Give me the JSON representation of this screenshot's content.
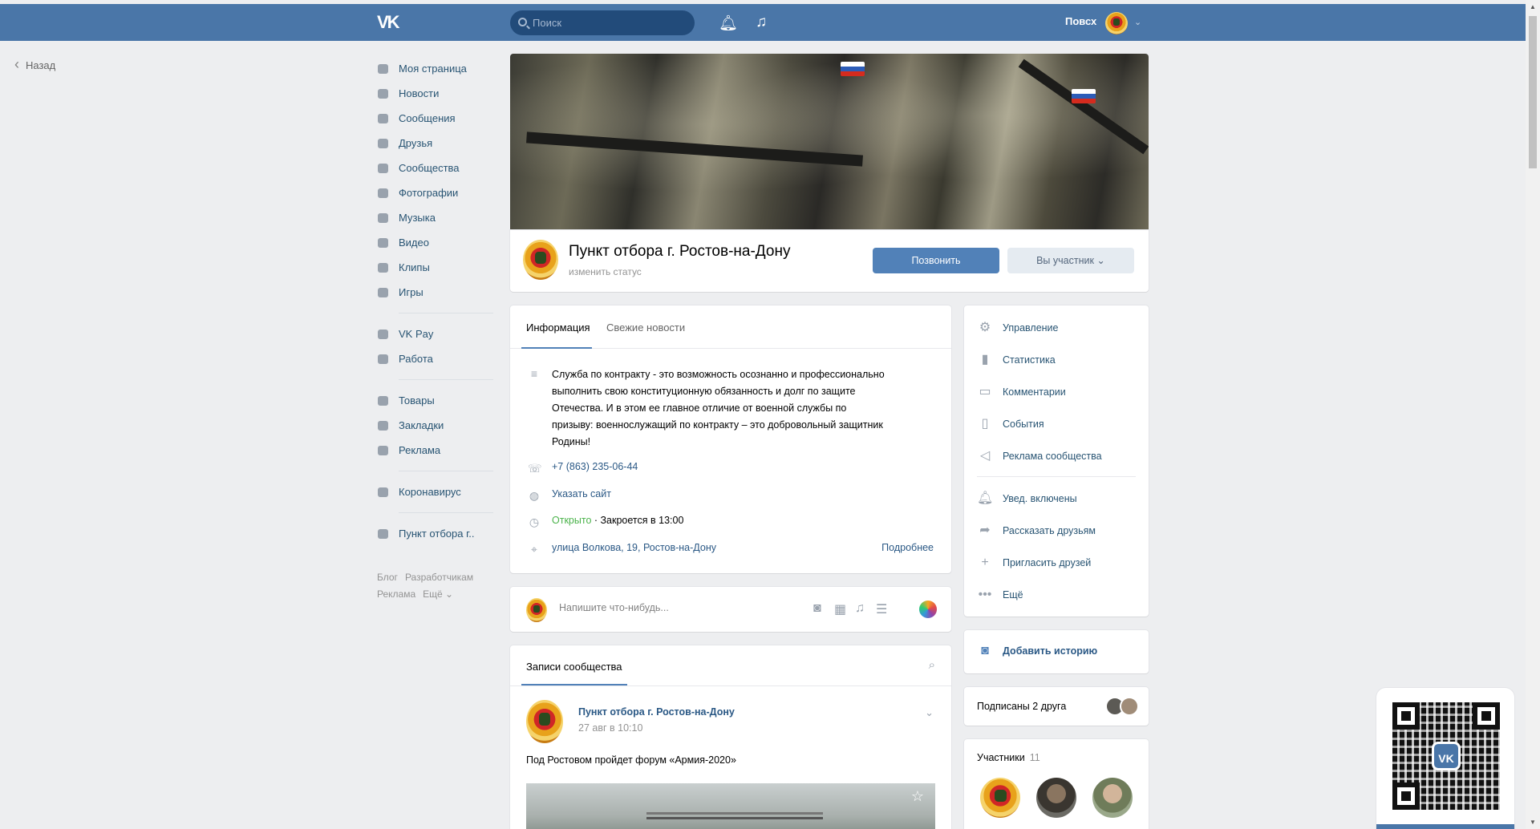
{
  "topbar": {
    "logo": "VK",
    "search_placeholder": "Поиск",
    "bell_icon": "bell-icon",
    "music_icon": "music-icon",
    "user_name": "Повсх"
  },
  "back": {
    "label": "Назад"
  },
  "leftnav": {
    "items": [
      {
        "label": "Моя страница",
        "icon": "home-icon"
      },
      {
        "label": "Новости",
        "icon": "news-icon"
      },
      {
        "label": "Сообщения",
        "icon": "messages-icon"
      },
      {
        "label": "Друзья",
        "icon": "friends-icon"
      },
      {
        "label": "Сообщества",
        "icon": "groups-icon"
      },
      {
        "label": "Фотографии",
        "icon": "camera-icon"
      },
      {
        "label": "Музыка",
        "icon": "music-icon"
      },
      {
        "label": "Видео",
        "icon": "video-icon"
      },
      {
        "label": "Клипы",
        "icon": "clips-icon"
      },
      {
        "label": "Игры",
        "icon": "games-icon"
      }
    ],
    "items2": [
      {
        "label": "VK Pay",
        "icon": "vkpay-icon"
      },
      {
        "label": "Работа",
        "icon": "work-icon"
      }
    ],
    "items3": [
      {
        "label": "Товары",
        "icon": "goods-icon"
      },
      {
        "label": "Закладки",
        "icon": "bookmark-icon"
      },
      {
        "label": "Реклама",
        "icon": "ads-icon"
      }
    ],
    "items4": [
      {
        "label": "Коронавирус",
        "icon": "virus-icon"
      }
    ],
    "items5": [
      {
        "label": "Пункт отбора г..",
        "icon": "group-icon"
      }
    ],
    "footer": [
      "Блог",
      "Разработчикам",
      "Реклама",
      "Ещё ⌄"
    ]
  },
  "group": {
    "name": "Пункт отбора г. Ростов-на-Дону",
    "status": "изменить статус",
    "call_label": "Позвонить",
    "member_label": "Вы участник ⌄"
  },
  "info": {
    "tabs": [
      "Информация",
      "Свежие новости"
    ],
    "description": "Служба по контракту - это возможность осознанно и профессионально выполнить свою конституционную обязанность и долг по защите Отечества. И в этом ее главное отличие от военной службы по призыву: военнослужащий по контракту – это добровольный защитник Родины!",
    "phone": "+7 (863) 235-06-44",
    "site": "Указать сайт",
    "open_status": "Открыто",
    "closes": "· Закроется в 13:00",
    "address": "улица Волкова, 19, Ростов-на-Дону",
    "more": "Подробнее"
  },
  "post_form": {
    "placeholder": "Напишите что-нибудь..."
  },
  "wall": {
    "tab": "Записи сообщества",
    "post_author": "Пункт отбора г. Ростов-на-Дону",
    "post_date": "27 авг в 10:10",
    "post_text": "Под Ростовом пройдет форум «Армия-2020»"
  },
  "side_actions": {
    "items": [
      "Управление",
      "Статистика",
      "Комментарии",
      "События",
      "Реклама сообщества"
    ],
    "items2": [
      "Увед. включены",
      "Рассказать друзьям",
      "Пригласить друзей",
      "Ещё"
    ]
  },
  "story": {
    "label": "Добавить историю"
  },
  "friends": {
    "label": "Подписаны 2 друга"
  },
  "members": {
    "label": "Участники",
    "count": "11"
  },
  "colors": {
    "header": "#4a76a8",
    "accent": "#5181b8",
    "link": "#2a5885",
    "bg": "#edeef0"
  }
}
